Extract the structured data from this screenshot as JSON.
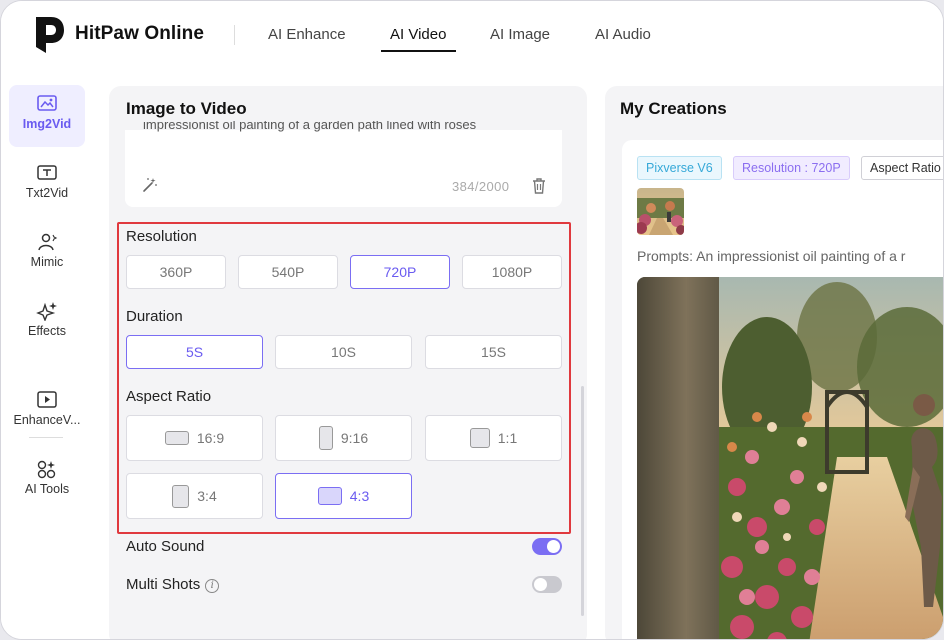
{
  "header": {
    "brand": "HitPaw Online",
    "tabs": [
      {
        "label": "AI Enhance"
      },
      {
        "label": "AI Video"
      },
      {
        "label": "AI Image"
      },
      {
        "label": "AI Audio"
      }
    ],
    "active_tab": "AI Video"
  },
  "sidebar": {
    "items": [
      {
        "label": "Img2Vid",
        "icon": "image-icon",
        "active": true
      },
      {
        "label": "Txt2Vid",
        "icon": "text-frame-icon"
      },
      {
        "label": "Mimic",
        "icon": "person-icon"
      },
      {
        "label": "Effects",
        "icon": "sparkle-icon"
      },
      {
        "label": "EnhanceV...",
        "icon": "video-enhance-icon"
      },
      {
        "label": "AI Tools",
        "icon": "tools-icon"
      }
    ]
  },
  "left_panel": {
    "title": "Image to Video",
    "prompt": {
      "partial_text": "impressionist oil painting of a garden path lined with roses",
      "counter": "384/2000"
    },
    "resolution": {
      "label": "Resolution",
      "options": [
        "360P",
        "540P",
        "720P",
        "1080P"
      ],
      "selected": "720P"
    },
    "duration": {
      "label": "Duration",
      "options": [
        "5S",
        "10S",
        "15S"
      ],
      "selected": "5S"
    },
    "aspect_ratio": {
      "label": "Aspect Ratio",
      "options": [
        "16:9",
        "9:16",
        "1:1",
        "3:4",
        "4:3"
      ],
      "selected": "4:3"
    },
    "auto_sound": {
      "label": "Auto Sound",
      "on": true
    },
    "multi_shots": {
      "label": "Multi Shots",
      "info": "i",
      "on": false
    }
  },
  "right_panel": {
    "title": "My Creations",
    "tags": [
      "Pixverse V6",
      "Resolution : 720P",
      "Aspect Ratio"
    ],
    "prompt_line": "Prompts: An impressionist oil painting of a r"
  },
  "colors": {
    "accent": "#7b6ef3",
    "highlight_border": "#e0393e",
    "panel_bg": "#f4f4f6"
  }
}
